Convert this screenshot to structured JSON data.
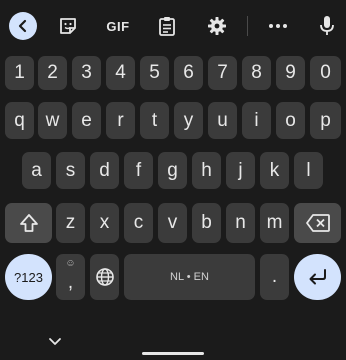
{
  "toolbar": {
    "back_icon": "chevron-left-icon",
    "sticker_icon": "sticker-icon",
    "gif_label": "GIF",
    "clipboard_icon": "clipboard-icon",
    "settings_icon": "gear-icon",
    "more_icon": "more-horizontal-icon",
    "mic_icon": "mic-icon"
  },
  "rows": {
    "numbers": [
      "1",
      "2",
      "3",
      "4",
      "5",
      "6",
      "7",
      "8",
      "9",
      "0"
    ],
    "row1": [
      "q",
      "w",
      "e",
      "r",
      "t",
      "y",
      "u",
      "i",
      "o",
      "p"
    ],
    "row2": [
      "a",
      "s",
      "d",
      "f",
      "g",
      "h",
      "j",
      "k",
      "l"
    ],
    "row3": [
      "z",
      "x",
      "c",
      "v",
      "b",
      "n",
      "m"
    ]
  },
  "keys": {
    "symbols": "?123",
    "comma": ",",
    "emoji_hint": "☺",
    "space": "NL • EN",
    "period": "."
  },
  "colors": {
    "background": "#1b1b1b",
    "key": "#3b3b3b",
    "function_key": "#4a4a4a",
    "accent": "#d3e3fd"
  }
}
